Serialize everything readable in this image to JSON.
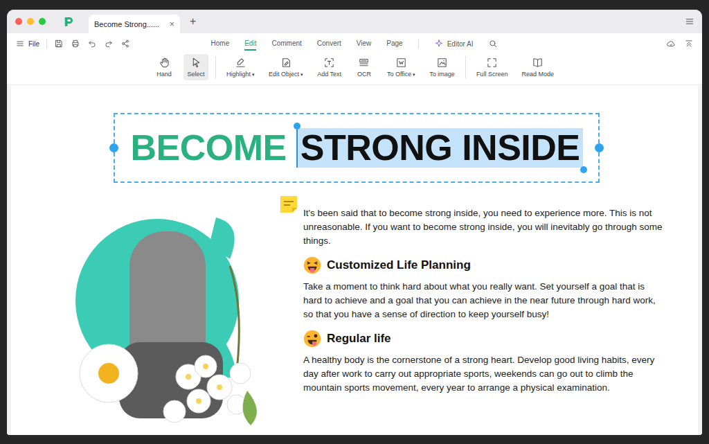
{
  "window": {
    "tab_title": "Become Strong......",
    "tab_close": "×",
    "new_tab": "+"
  },
  "menubar": {
    "file": "File"
  },
  "nav_tabs": [
    {
      "label": "Home",
      "selected": false
    },
    {
      "label": "Edit",
      "selected": true
    },
    {
      "label": "Comment",
      "selected": false
    },
    {
      "label": "Convert",
      "selected": false
    },
    {
      "label": "View",
      "selected": false
    },
    {
      "label": "Page",
      "selected": false
    }
  ],
  "editor_ai": {
    "label": "Editor AI"
  },
  "dropdown_caret": "▾",
  "tool_groups": [
    [
      {
        "label": "Hand",
        "selected": false,
        "dropdown": false
      },
      {
        "label": "Select",
        "selected": true,
        "dropdown": false
      }
    ],
    [
      {
        "label": "Highlight",
        "selected": false,
        "dropdown": true
      },
      {
        "label": "Edit Object",
        "selected": false,
        "dropdown": true
      },
      {
        "label": "Add Text",
        "selected": false,
        "dropdown": false
      },
      {
        "label": "OCR",
        "selected": false,
        "dropdown": false
      },
      {
        "label": "To Office",
        "selected": false,
        "dropdown": true
      },
      {
        "label": "To image",
        "selected": false,
        "dropdown": false
      }
    ],
    [
      {
        "label": "Full Screen",
        "selected": false,
        "dropdown": false
      },
      {
        "label": "Read Mode",
        "selected": false,
        "dropdown": false
      }
    ]
  ],
  "document": {
    "title_parts": [
      {
        "text": "BECOME",
        "color": "#2bb07f",
        "selected": false
      },
      {
        "text": "STRONG INSIDE",
        "color": "#111111",
        "selected": true
      }
    ],
    "intro": "It's been said that to become strong inside, you need to experience more. This is not unreasonable. If you want to become strong inside, you will inevitably go through some things.",
    "sections": [
      {
        "heading": "Customized Life Planning",
        "body": "Take a moment to think hard about what you really want. Set yourself a goal that is hard to achieve and a goal that you can achieve in the near future through hard work, so that you have a sense of direction to keep yourself busy!"
      },
      {
        "heading": "Regular life",
        "body": "A healthy body is the cornerstone of a strong heart. Develop good living habits, every day after work to carry out appropriate sports, weekends can go out to climb the mountain sports movement, every year to arrange a physical examination."
      }
    ]
  }
}
